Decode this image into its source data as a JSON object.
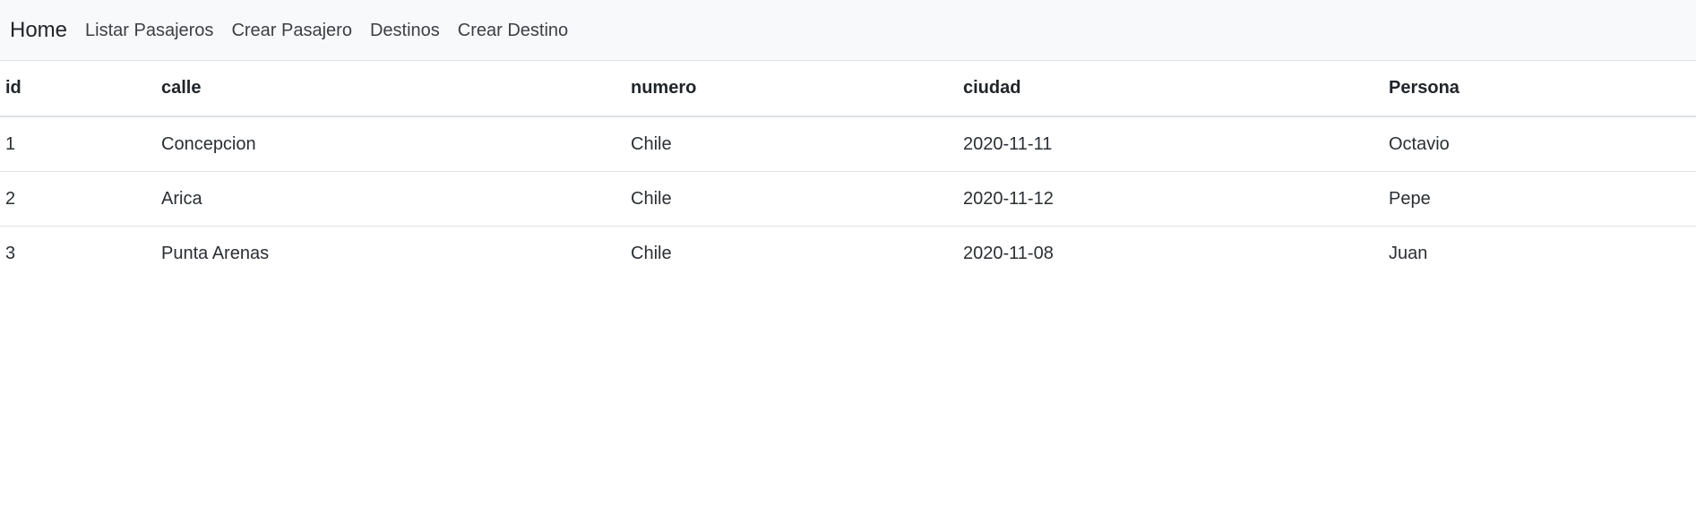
{
  "navbar": {
    "brand": "Home",
    "links": [
      {
        "label": "Listar Pasajeros"
      },
      {
        "label": "Crear Pasajero"
      },
      {
        "label": "Destinos"
      },
      {
        "label": "Crear Destino"
      }
    ],
    "background_color": "#f8f9fa"
  },
  "table": {
    "headers": [
      "id",
      "calle",
      "numero",
      "ciudad",
      "Persona"
    ],
    "rows": [
      [
        "1",
        "Concepcion",
        "Chile",
        "2020-11-11",
        "Octavio"
      ],
      [
        "2",
        "Arica",
        "Chile",
        "2020-11-12",
        "Pepe"
      ],
      [
        "3",
        "Punta Arenas",
        "Chile",
        "2020-11-08",
        "Juan"
      ]
    ]
  }
}
